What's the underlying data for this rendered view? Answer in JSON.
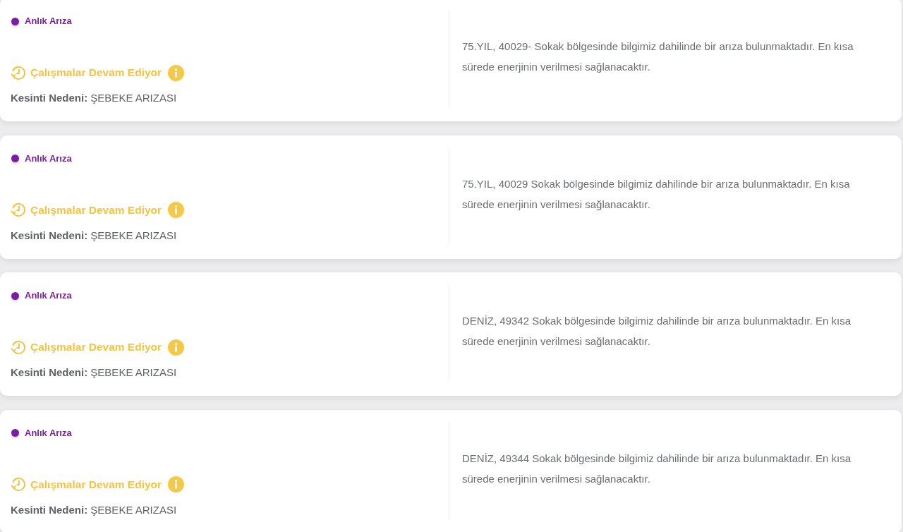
{
  "cards": [
    {
      "tag": {
        "label": "Anlık Arıza"
      },
      "status": {
        "label": "Çalışmalar Devam Ediyor"
      },
      "reason": {
        "label": "Kesinti Nedeni:",
        "value": "ŞEBEKE ARIZASI"
      },
      "description": "75.YIL, 40029- Sokak bölgesinde bilgimiz dahilinde bir arıza bulunmaktadır. En kısa sürede enerjinin verilmesi sağlanacaktır."
    },
    {
      "tag": {
        "label": "Anlık Arıza"
      },
      "status": {
        "label": "Çalışmalar Devam Ediyor"
      },
      "reason": {
        "label": "Kesinti Nedeni:",
        "value": "ŞEBEKE ARIZASI"
      },
      "description": "75.YIL, 40029 Sokak bölgesinde bilgimiz dahilinde bir arıza bulunmaktadır. En kısa sürede enerjinin verilmesi sağlanacaktır."
    },
    {
      "tag": {
        "label": "Anlık Arıza"
      },
      "status": {
        "label": "Çalışmalar Devam Ediyor"
      },
      "reason": {
        "label": "Kesinti Nedeni:",
        "value": "ŞEBEKE ARIZASI"
      },
      "description": "DENİZ, 49342 Sokak bölgesinde bilgimiz dahilinde bir arıza bulunmaktadır. En kısa sürede enerjinin verilmesi sağlanacaktır."
    },
    {
      "tag": {
        "label": "Anlık Arıza"
      },
      "status": {
        "label": "Çalışmalar Devam Ediyor"
      },
      "reason": {
        "label": "Kesinti Nedeni:",
        "value": "ŞEBEKE ARIZASI"
      },
      "description": "DENİZ, 49344 Sokak bölgesinde bilgimiz dahilinde bir arıza bulunmaktadır. En kısa sürede enerjinin verilmesi sağlanacaktır."
    }
  ]
}
